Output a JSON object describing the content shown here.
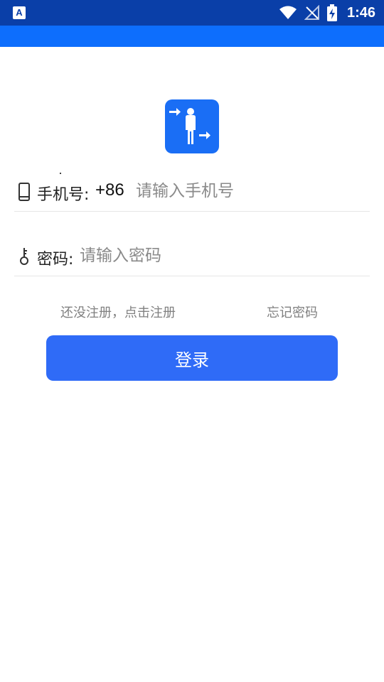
{
  "status_bar": {
    "time": "1:46",
    "left_icon": "A",
    "icons": [
      "wifi-icon",
      "signal-off-icon",
      "battery-charging-icon"
    ]
  },
  "colors": {
    "status_bar": "#0a3fa8",
    "app_bar": "#0d6efd",
    "accent": "#2f6bf7",
    "logo": "#1a6ef5"
  },
  "logo": {
    "icon": "person-transfer-icon"
  },
  "phone": {
    "label": "手机号:",
    "prefix": "+86",
    "placeholder": "请输入手机号",
    "value": "",
    "icon": "phone-icon"
  },
  "password": {
    "label": "密码:",
    "placeholder": "请输入密码",
    "value": "",
    "icon": "key-icon"
  },
  "links": {
    "register": "还没注册，点击注册",
    "forgot": "忘记密码"
  },
  "login_button": {
    "label": "登录"
  }
}
